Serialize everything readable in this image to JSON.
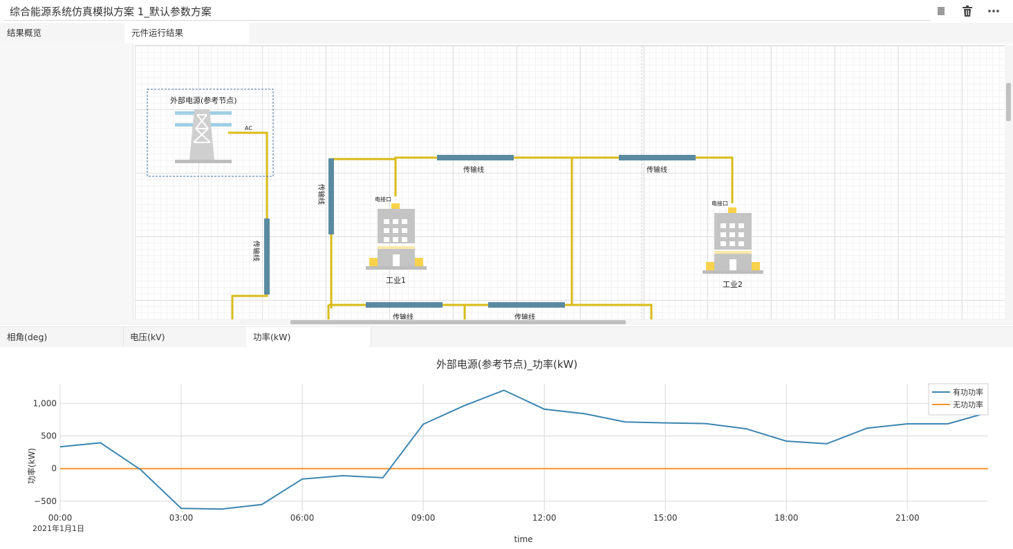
{
  "header": {
    "title": "综合能源系统仿真模拟方案 1_默认参数方案",
    "icons": [
      "stop-icon",
      "trash-icon",
      "more-icon"
    ]
  },
  "top_tabs": [
    {
      "label": "结果概览",
      "active": false
    },
    {
      "label": "元件运行结果",
      "active": true
    }
  ],
  "diagram": {
    "source_label": "外部电源(参考节点)",
    "ac_label": "AC",
    "line_label": "传输线",
    "port_label": "电接口",
    "factory1_label": "工业1",
    "factory2_label": "工业2"
  },
  "bottom_tabs": [
    {
      "label": "相角(deg)",
      "active": false
    },
    {
      "label": "电压(kV)",
      "active": false
    },
    {
      "label": "功率(kW)",
      "active": true
    }
  ],
  "colors": {
    "active_power": "#3a84b0",
    "reactive_power": "#f5922f",
    "line": "#d9bb17",
    "transmission": "#5a8aa0"
  },
  "chart_data": {
    "type": "line",
    "title": "外部电源(参考节点)_功率(kW)",
    "xlabel": "time",
    "ylabel": "功率(kW)",
    "x": [
      "00:00",
      "01:00",
      "02:00",
      "03:00",
      "04:00",
      "05:00",
      "06:00",
      "07:00",
      "08:00",
      "09:00",
      "10:00",
      "11:00",
      "12:00",
      "13:00",
      "14:00",
      "15:00",
      "16:00",
      "17:00",
      "18:00",
      "19:00",
      "20:00",
      "21:00",
      "22:00",
      "23:00"
    ],
    "x_ticks": [
      "00:00",
      "03:00",
      "06:00",
      "09:00",
      "12:00",
      "15:00",
      "18:00",
      "21:00"
    ],
    "x_sublabel": "2021年1月1日",
    "y_ticks": [
      1000,
      500,
      0,
      -500
    ],
    "ylim": [
      -650,
      1300
    ],
    "series": [
      {
        "name": "有功功率",
        "values": [
          335,
          395,
          -20,
          -610,
          -620,
          -550,
          -160,
          -110,
          -140,
          680,
          960,
          1200,
          910,
          840,
          715,
          700,
          690,
          610,
          420,
          380,
          620,
          685,
          685,
          860
        ]
      },
      {
        "name": "无功功率",
        "values": [
          0,
          0,
          0,
          0,
          0,
          0,
          0,
          0,
          0,
          0,
          0,
          0,
          0,
          0,
          0,
          0,
          0,
          0,
          0,
          0,
          0,
          0,
          0,
          0
        ]
      }
    ],
    "grid": true,
    "legend": "top-right"
  }
}
